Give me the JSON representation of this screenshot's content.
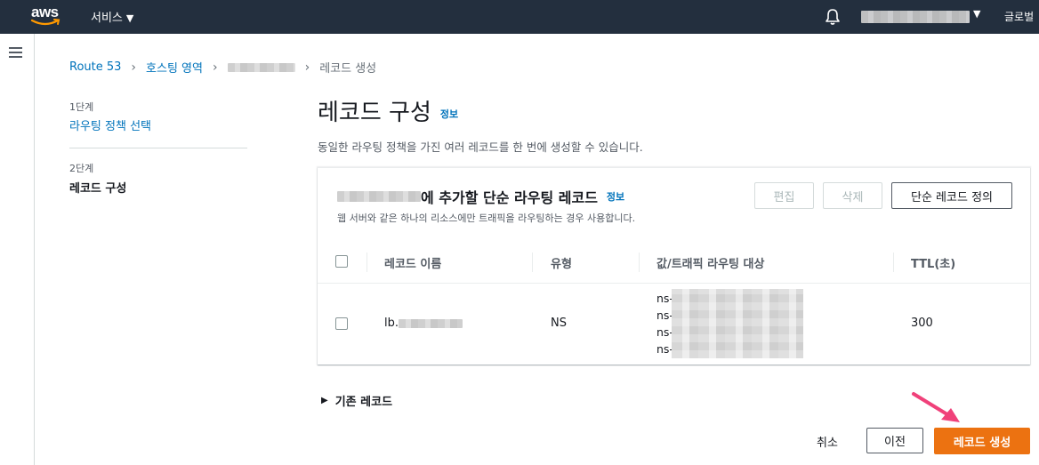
{
  "topbar": {
    "logo_text": "aws",
    "services_label": "서비스",
    "region_label": "글로벌"
  },
  "breadcrumb": {
    "root": "Route 53",
    "hosted_zones": "호스팅 영역",
    "current": "레코드 생성"
  },
  "wizard": {
    "step1_small": "1단계",
    "step1_link": "라우팅 정책 선택",
    "step2_small": "2단계",
    "step2_label": "레코드 구성"
  },
  "page": {
    "title": "레코드 구성",
    "info": "정보",
    "description": "동일한 라우팅 정책을 가진 여러 레코드를 한 번에 생성할 수 있습니다."
  },
  "panel": {
    "title_suffix": "에 추가할 단순 라우팅 레코드",
    "info": "정보",
    "subtitle": "웹 서버와 같은 하나의 리소스에만 트래픽을 라우팅하는 경우 사용합니다.",
    "edit_label": "편집",
    "delete_label": "삭제",
    "define_label": "단순 레코드 정의"
  },
  "table": {
    "columns": [
      "레코드 이름",
      "유형",
      "값/트래픽 라우팅 대상",
      "TTL(초)"
    ],
    "rows": [
      {
        "name_prefix": "lb.",
        "type": "NS",
        "values": [
          "ns-",
          "ns-",
          "ns-",
          "ns-"
        ],
        "ttl": "300"
      }
    ]
  },
  "existing_records_label": "기존 레코드",
  "footer": {
    "cancel_label": "취소",
    "prev_label": "이전",
    "create_label": "레코드 생성"
  },
  "colors": {
    "topbar": "#232f3e",
    "link": "#0073bb",
    "primary": "#ec7211",
    "annotation_arrow": "#f0417a"
  }
}
